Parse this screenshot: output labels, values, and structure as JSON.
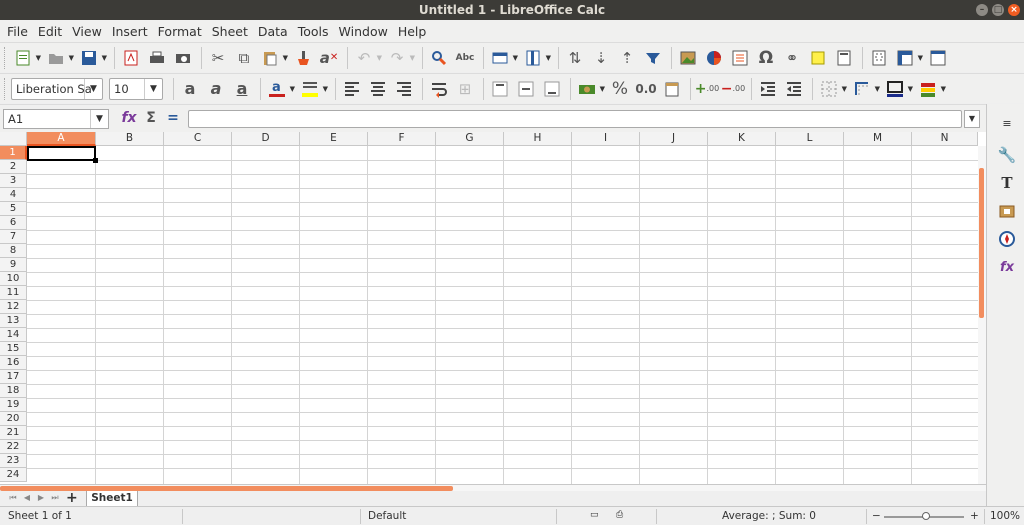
{
  "window": {
    "title": "Untitled 1 - LibreOffice Calc"
  },
  "menu": [
    "File",
    "Edit",
    "View",
    "Insert",
    "Format",
    "Sheet",
    "Data",
    "Tools",
    "Window",
    "Help"
  ],
  "format": {
    "font_name": "Liberation Sa",
    "font_size": "10"
  },
  "formula_bar": {
    "cell_ref": "A1",
    "content": ""
  },
  "columns": [
    "A",
    "B",
    "C",
    "D",
    "E",
    "F",
    "G",
    "H",
    "I",
    "J",
    "K",
    "L",
    "M",
    "N"
  ],
  "rows": [
    "1",
    "2",
    "3",
    "4",
    "5",
    "6",
    "7",
    "8",
    "9",
    "10",
    "11",
    "12",
    "13",
    "14",
    "15",
    "16",
    "17",
    "18",
    "19",
    "20",
    "21",
    "22",
    "23",
    "24"
  ],
  "active_cell": {
    "column": "A",
    "row": "1"
  },
  "sheets": {
    "add": "+",
    "tabs": [
      "Sheet1"
    ],
    "active": "Sheet1"
  },
  "status": {
    "sheet_position": "Sheet 1 of 1",
    "page_style": "Default",
    "selection_summary": "Average: ; Sum: 0",
    "zoom": "100%",
    "zoom_out": "−",
    "zoom_in": "+"
  },
  "toolbar_text": {
    "percent": "%",
    "decimal": "0.0",
    "addDecimal": ".00",
    "removeDecimal": ".00"
  },
  "colors": {
    "accent": "#e95420",
    "header_active": "#f28d5e",
    "font_color": "#c9211e",
    "highlight": "#ffff00",
    "titlebar": "#3c3b37"
  }
}
